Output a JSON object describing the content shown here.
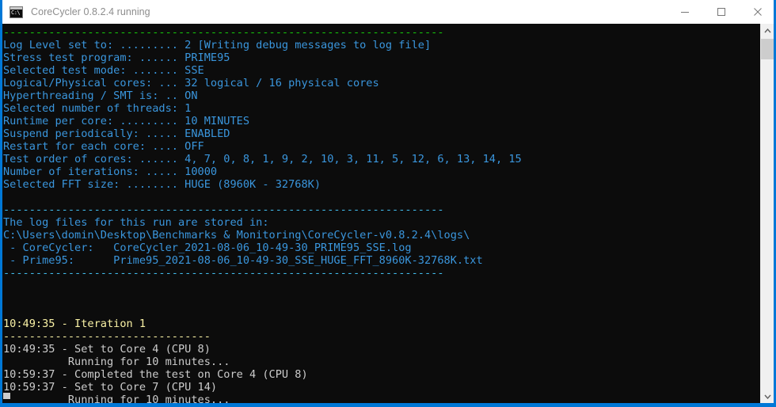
{
  "window": {
    "title": "CoreCycler 0.8.2.4 running",
    "icon_name": "console-app-icon",
    "icon_prompt": "C:\\",
    "minimize_label": "Minimize",
    "maximize_label": "Maximize",
    "close_label": "Close",
    "accent_color": "#0078d7",
    "titlebar_bg": "#ffffff",
    "title_color": "#8d8d8d"
  },
  "console": {
    "background": "#0c0c0c",
    "colors": {
      "green": "#16c60c",
      "cyan": "#3a96dd",
      "dash_cyan": "#41b9e8",
      "yellow": "#f9f1a5",
      "white": "#cccccc"
    },
    "lines": [
      {
        "text": "--------------------------------------------------------------------",
        "color": "green"
      },
      {
        "text": "Log Level set to: ......... 2 [Writing debug messages to log file]",
        "color": "cyan"
      },
      {
        "text": "Stress test program: ...... PRIME95",
        "color": "cyan"
      },
      {
        "text": "Selected test mode: ....... SSE",
        "color": "cyan"
      },
      {
        "text": "Logical/Physical cores: ... 32 logical / 16 physical cores",
        "color": "cyan"
      },
      {
        "text": "Hyperthreading / SMT is: .. ON",
        "color": "cyan"
      },
      {
        "text": "Selected number of threads: 1",
        "color": "cyan"
      },
      {
        "text": "Runtime per core: ......... 10 MINUTES",
        "color": "cyan"
      },
      {
        "text": "Suspend periodically: ..... ENABLED",
        "color": "cyan"
      },
      {
        "text": "Restart for each core: .... OFF",
        "color": "cyan"
      },
      {
        "text": "Test order of cores: ...... 4, 7, 0, 8, 1, 9, 2, 10, 3, 11, 5, 12, 6, 13, 14, 15",
        "color": "cyan"
      },
      {
        "text": "Number of iterations: ..... 10000",
        "color": "cyan"
      },
      {
        "text": "Selected FFT size: ........ HUGE (8960K - 32768K)",
        "color": "cyan"
      },
      {
        "text": "",
        "color": "cyan"
      },
      {
        "text": "--------------------------------------------------------------------",
        "color": "dash_cyan"
      },
      {
        "text": "The log files for this run are stored in:",
        "color": "cyan"
      },
      {
        "text": "C:\\Users\\domin\\Desktop\\Benchmarks & Monitoring\\CoreCycler-v0.8.2.4\\logs\\",
        "color": "cyan"
      },
      {
        "text": " - CoreCycler:   CoreCycler_2021-08-06_10-49-30_PRIME95_SSE.log",
        "color": "cyan"
      },
      {
        "text": " - Prime95:      Prime95_2021-08-06_10-49-30_SSE_HUGE_FFT_8960K-32768K.txt",
        "color": "cyan"
      },
      {
        "text": "--------------------------------------------------------------------",
        "color": "dash_cyan"
      },
      {
        "text": "",
        "color": "cyan"
      },
      {
        "text": "",
        "color": "cyan"
      },
      {
        "text": "",
        "color": "cyan"
      },
      {
        "text": "10:49:35 - Iteration 1",
        "color": "yellow"
      },
      {
        "text": "--------------------------------",
        "color": "yellow"
      },
      {
        "text": "10:49:35 - Set to Core 4 (CPU 8)",
        "color": "white"
      },
      {
        "text": "          Running for 10 minutes...",
        "color": "white"
      },
      {
        "text": "10:59:37 - Completed the test on Core 4 (CPU 8)",
        "color": "white"
      },
      {
        "text": "10:59:37 - Set to Core 7 (CPU 14)",
        "color": "white"
      },
      {
        "text": "          Running for 10 minutes...",
        "color": "white"
      }
    ]
  },
  "scrollbar": {
    "up_arrow_name": "scroll-up-arrow",
    "down_arrow_name": "scroll-down-arrow",
    "thumb_name": "scroll-thumb"
  }
}
